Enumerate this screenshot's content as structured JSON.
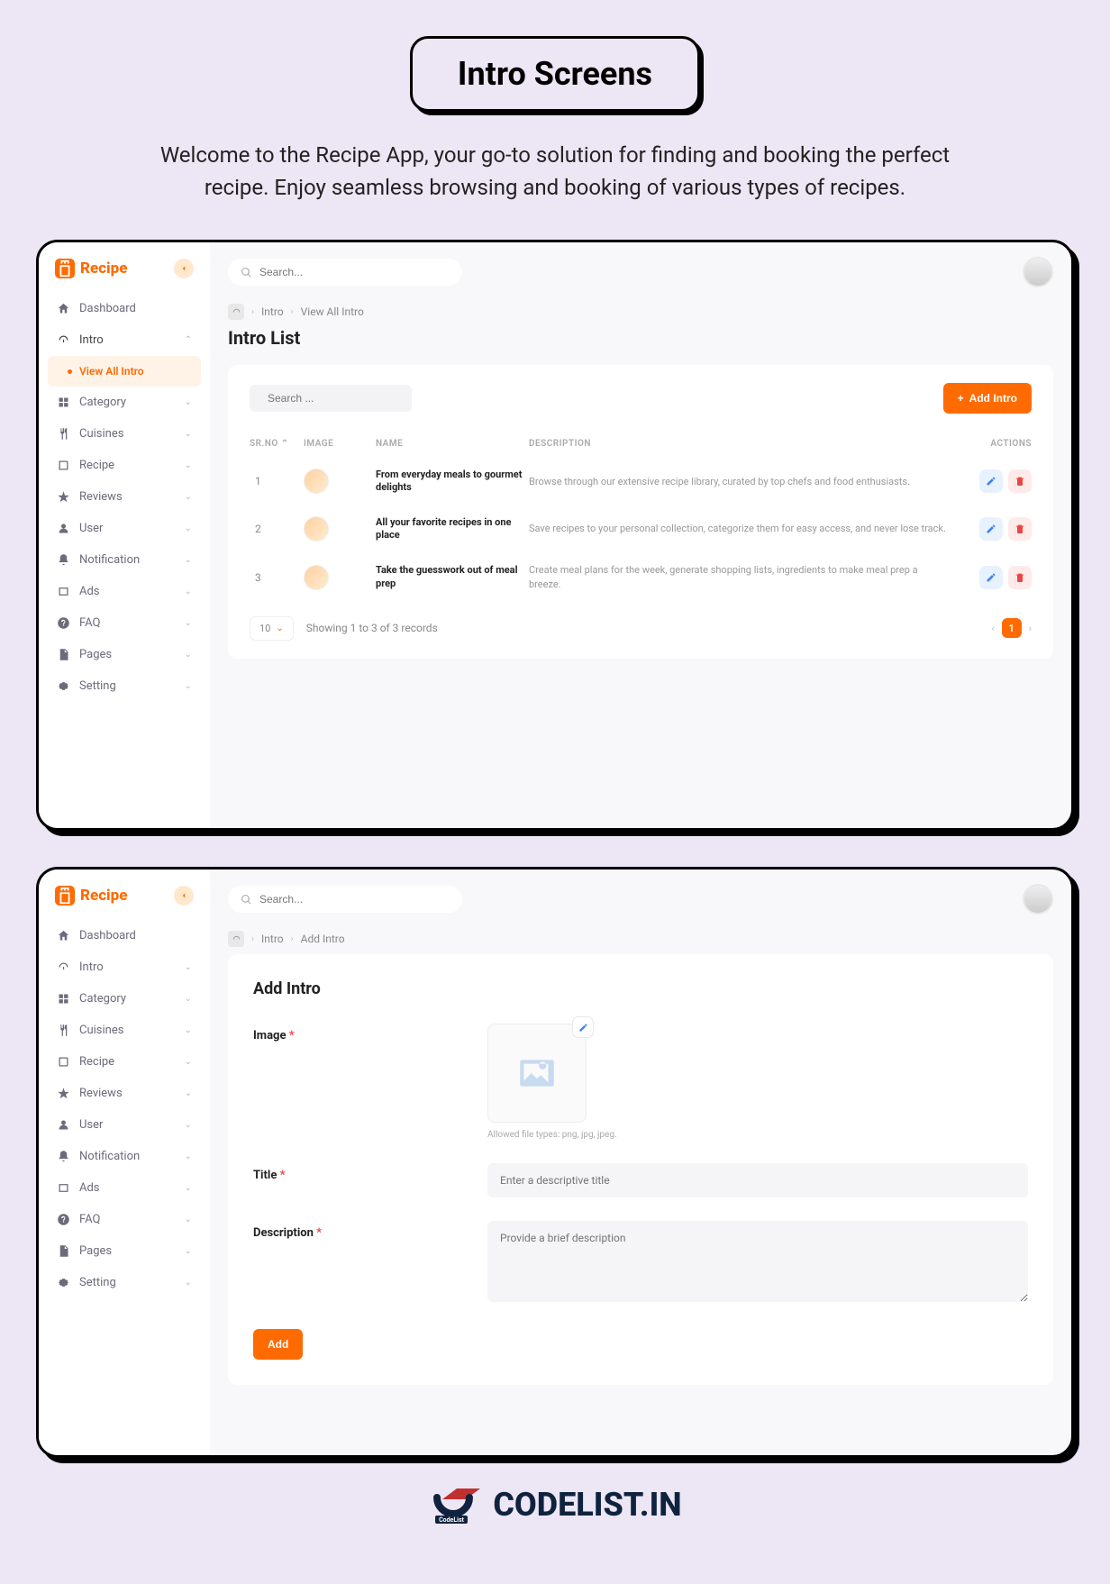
{
  "banner": {
    "title": "Intro Screens",
    "text": "Welcome to the Recipe App, your go-to solution for finding and booking the perfect recipe. Enjoy seamless browsing and booking of various types of recipes."
  },
  "brand": {
    "name": "Recipe"
  },
  "search": {
    "placeholder": "Search..."
  },
  "nav": {
    "dashboard": "Dashboard",
    "intro": "Intro",
    "view_all_intro": "View All Intro",
    "category": "Category",
    "cuisines": "Cuisines",
    "recipe": "Recipe",
    "reviews": "Reviews",
    "user": "User",
    "notification": "Notification",
    "ads": "Ads",
    "faq": "FAQ",
    "pages": "Pages",
    "setting": "Setting"
  },
  "list": {
    "breadcrumb1": "Intro",
    "breadcrumb2": "View All Intro",
    "title": "Intro List",
    "search_placeholder": "Search ...",
    "add_btn": "Add Intro",
    "cols": {
      "sr": "SR.NO",
      "image": "IMAGE",
      "name": "NAME",
      "desc": "DESCRIPTION",
      "actions": "ACTIONS"
    },
    "rows": [
      {
        "sr": "1",
        "name": "From everyday meals to gourmet delights",
        "desc": "Browse through our extensive recipe library, curated by top chefs and food enthusiasts."
      },
      {
        "sr": "2",
        "name": "All your favorite recipes in one place",
        "desc": "Save recipes to your personal collection, categorize them for easy access, and never lose track."
      },
      {
        "sr": "3",
        "name": "Take the guesswork out of meal prep",
        "desc": "Create meal plans for the week, generate shopping lists, ingredients to make meal prep a breeze."
      }
    ],
    "page_size": "10",
    "showing": "Showing 1 to 3 of 3 records",
    "current_page": "1"
  },
  "add": {
    "breadcrumb1": "Intro",
    "breadcrumb2": "Add Intro",
    "title": "Add Intro",
    "image_label": "Image",
    "help": "Allowed file types: png, jpg, jpeg.",
    "title_label": "Title",
    "title_placeholder": "Enter a descriptive title",
    "desc_label": "Description",
    "desc_placeholder": "Provide a brief description",
    "submit": "Add"
  },
  "footer": {
    "brand": "CODELIST.IN"
  }
}
